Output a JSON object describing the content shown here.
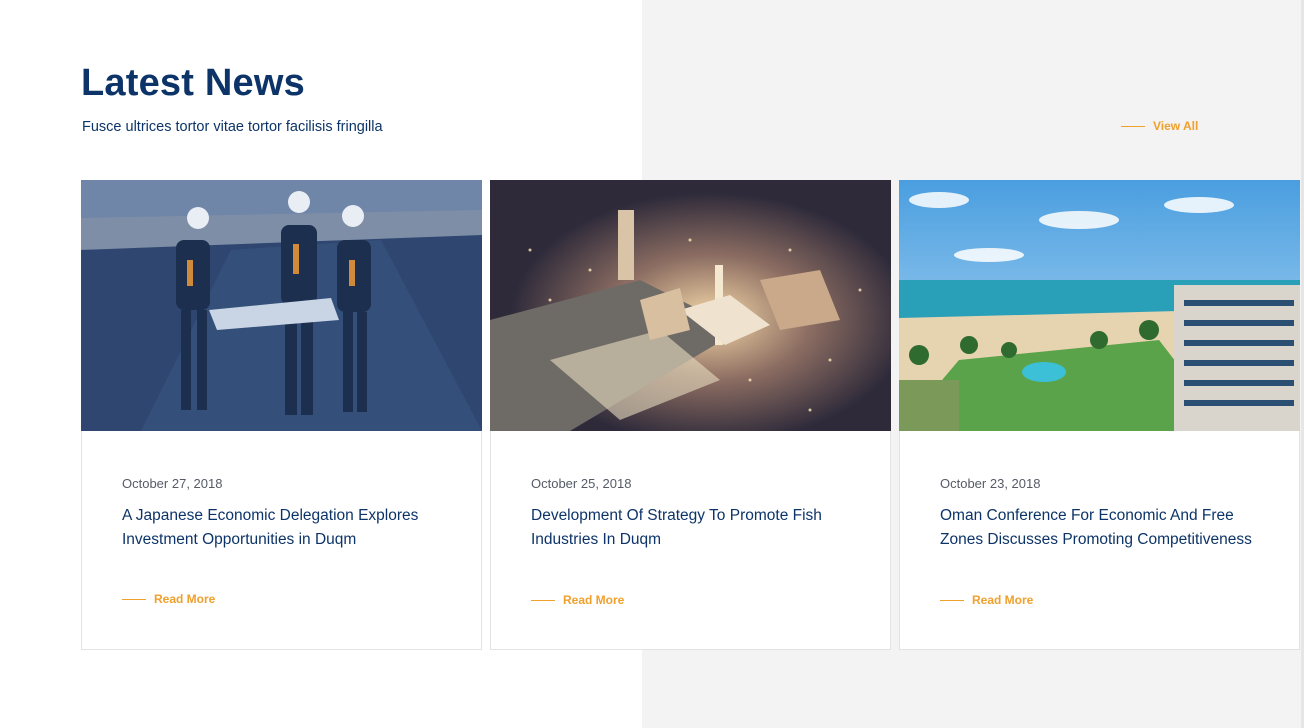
{
  "section": {
    "title": "Latest News",
    "subtitle": "Fusce ultrices tortor vitae tortor facilisis fringilla",
    "view_all_label": "View All"
  },
  "articles": [
    {
      "date": "October 27, 2018",
      "headline": "A Japanese Economic Delegation Explores Investment Opportunities in Duqm",
      "read_more_label": "Read More",
      "image_icon": "engineers-on-road-photo"
    },
    {
      "date": "October 25, 2018",
      "headline": "Development Of Strategy To Promote Fish Industries In Duqm",
      "read_more_label": "Read More",
      "image_icon": "city-model-night-photo"
    },
    {
      "date": "October 23, 2018",
      "headline": "Oman Conference For Economic And Free Zones Discusses Promoting Competitiveness",
      "read_more_label": "Read More",
      "image_icon": "beach-resort-photo"
    }
  ],
  "colors": {
    "primary": "#0d3468",
    "accent": "#f0a02c",
    "muted_text": "#555b66",
    "right_panel_bg": "#f3f3f3"
  }
}
